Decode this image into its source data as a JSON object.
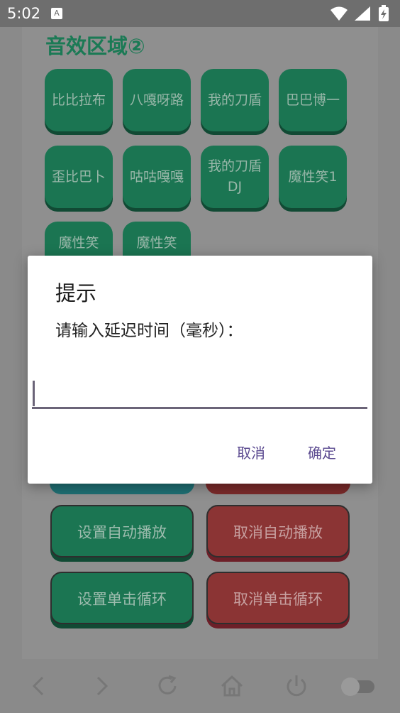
{
  "status_bar": {
    "time": "5:02",
    "notification_icon": "a-notification-icon",
    "icons": [
      "wifi-icon",
      "cell-signal-icon",
      "battery-icon"
    ]
  },
  "section": {
    "title": "音效区域②",
    "pads": [
      {
        "label": "比比拉布"
      },
      {
        "label": "八嘎呀路"
      },
      {
        "label": "我的刀盾"
      },
      {
        "label": "巴巴博一"
      },
      {
        "label": "歪比巴卜"
      },
      {
        "label": "咕咕嘎嘎"
      },
      {
        "label": "我的刀盾DJ"
      },
      {
        "label": "魔性笑1"
      },
      {
        "label": "魔性笑"
      },
      {
        "label": "魔性笑"
      }
    ]
  },
  "controls": {
    "set_auto_play": "设置自动播放",
    "cancel_auto_play": "取消自动播放",
    "set_click_loop": "设置单击循环",
    "cancel_click_loop": "取消单击循环"
  },
  "dialog": {
    "title": "提示",
    "message": "请输入延迟时间（毫秒）：",
    "input_value": "",
    "cancel_label": "取消",
    "confirm_label": "确定"
  },
  "nav_bar": {
    "icons": [
      "back-arrow-icon",
      "forward-arrow-icon",
      "refresh-icon",
      "home-icon",
      "power-icon",
      "toggle-switch"
    ]
  },
  "colors": {
    "pad_green": "#1b7552",
    "pad_red": "#8b3434",
    "title_green": "#1b7a55",
    "dialog_accent": "#5b4a90"
  }
}
